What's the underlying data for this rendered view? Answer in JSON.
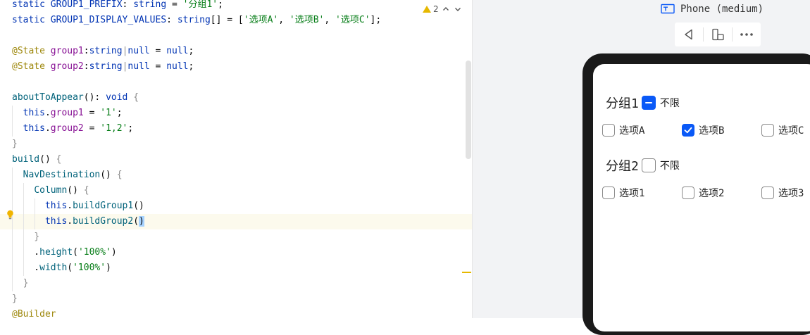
{
  "editor": {
    "warning_count": "2",
    "lines": [
      {
        "hl": false,
        "guides": [],
        "tokens": [
          [
            "k",
            "static "
          ],
          [
            "v",
            "GROUP1_PREFIX"
          ],
          [
            "n",
            ": "
          ],
          [
            "k",
            "string"
          ],
          [
            "n",
            " = "
          ],
          [
            "s",
            "'分组1'"
          ],
          [
            "n",
            ";"
          ]
        ]
      },
      {
        "hl": false,
        "guides": [],
        "tokens": [
          [
            "k",
            "static "
          ],
          [
            "v",
            "GROUP1_DISPLAY_VALUES"
          ],
          [
            "n",
            ": "
          ],
          [
            "k",
            "string"
          ],
          [
            "n",
            "[] = ["
          ],
          [
            "s",
            "'选项A'"
          ],
          [
            "n",
            ", "
          ],
          [
            "s",
            "'选项B'"
          ],
          [
            "n",
            ", "
          ],
          [
            "s",
            "'选项C'"
          ],
          [
            "n",
            "];"
          ]
        ]
      },
      {
        "hl": false,
        "guides": [],
        "tokens": []
      },
      {
        "hl": false,
        "guides": [],
        "tokens": [
          [
            "a",
            "@State "
          ],
          [
            "t",
            "group1"
          ],
          [
            "n",
            ":"
          ],
          [
            "k",
            "string"
          ],
          [
            "g",
            "|"
          ],
          [
            "k",
            "null"
          ],
          [
            "n",
            " = "
          ],
          [
            "k",
            "null"
          ],
          [
            "n",
            ";"
          ]
        ]
      },
      {
        "hl": false,
        "guides": [],
        "tokens": [
          [
            "a",
            "@State "
          ],
          [
            "t",
            "group2"
          ],
          [
            "n",
            ":"
          ],
          [
            "k",
            "string"
          ],
          [
            "g",
            "|"
          ],
          [
            "k",
            "null"
          ],
          [
            "n",
            " = "
          ],
          [
            "k",
            "null"
          ],
          [
            "n",
            ";"
          ]
        ]
      },
      {
        "hl": false,
        "guides": [],
        "tokens": []
      },
      {
        "hl": false,
        "guides": [],
        "tokens": [
          [
            "f",
            "aboutToAppear"
          ],
          [
            "n",
            "(): "
          ],
          [
            "k",
            "void "
          ],
          [
            "br",
            "{"
          ]
        ]
      },
      {
        "hl": false,
        "guides": [
          17
        ],
        "tokens": [
          [
            "n",
            "  "
          ],
          [
            "th",
            "this"
          ],
          [
            "n",
            "."
          ],
          [
            "t",
            "group1"
          ],
          [
            "n",
            " = "
          ],
          [
            "s",
            "'1'"
          ],
          [
            "n",
            ";"
          ]
        ]
      },
      {
        "hl": false,
        "guides": [
          17
        ],
        "tokens": [
          [
            "n",
            "  "
          ],
          [
            "th",
            "this"
          ],
          [
            "n",
            "."
          ],
          [
            "t",
            "group2"
          ],
          [
            "n",
            " = "
          ],
          [
            "s",
            "'1,2'"
          ],
          [
            "n",
            ";"
          ]
        ]
      },
      {
        "hl": false,
        "guides": [],
        "tokens": [
          [
            "br",
            "}"
          ]
        ]
      },
      {
        "hl": false,
        "guides": [],
        "tokens": [
          [
            "f",
            "build"
          ],
          [
            "n",
            "() "
          ],
          [
            "br",
            "{"
          ]
        ]
      },
      {
        "hl": false,
        "guides": [
          17
        ],
        "tokens": [
          [
            "n",
            "  "
          ],
          [
            "f",
            "NavDestination"
          ],
          [
            "n",
            "() "
          ],
          [
            "br",
            "{"
          ]
        ]
      },
      {
        "hl": false,
        "guides": [
          17,
          33
        ],
        "tokens": [
          [
            "n",
            "    "
          ],
          [
            "f",
            "Column"
          ],
          [
            "n",
            "() "
          ],
          [
            "br",
            "{"
          ]
        ]
      },
      {
        "hl": false,
        "guides": [
          17,
          33,
          49
        ],
        "tokens": [
          [
            "n",
            "      "
          ],
          [
            "th",
            "this"
          ],
          [
            "n",
            "."
          ],
          [
            "f",
            "buildGroup1"
          ],
          [
            "n",
            "()"
          ]
        ]
      },
      {
        "hl": true,
        "guides": [
          17,
          33,
          49
        ],
        "tokens": [
          [
            "n",
            "      "
          ],
          [
            "th",
            "this"
          ],
          [
            "n",
            "."
          ],
          [
            "f",
            "buildGroup2"
          ],
          [
            "n",
            "("
          ],
          [
            "c",
            ")"
          ]
        ]
      },
      {
        "hl": false,
        "guides": [
          17,
          33
        ],
        "tokens": [
          [
            "n",
            "    "
          ],
          [
            "br",
            "}"
          ]
        ]
      },
      {
        "hl": false,
        "guides": [
          17,
          33
        ],
        "tokens": [
          [
            "n",
            "    ."
          ],
          [
            "f",
            "height"
          ],
          [
            "n",
            "("
          ],
          [
            "s",
            "'100%'"
          ],
          [
            "n",
            ")"
          ]
        ]
      },
      {
        "hl": false,
        "guides": [
          17,
          33
        ],
        "tokens": [
          [
            "n",
            "    ."
          ],
          [
            "f",
            "width"
          ],
          [
            "n",
            "("
          ],
          [
            "s",
            "'100%'"
          ],
          [
            "n",
            ")"
          ]
        ]
      },
      {
        "hl": false,
        "guides": [
          17
        ],
        "tokens": [
          [
            "n",
            "  "
          ],
          [
            "br",
            "}"
          ]
        ]
      },
      {
        "hl": false,
        "guides": [],
        "tokens": [
          [
            "br",
            "}"
          ]
        ]
      },
      {
        "hl": false,
        "guides": [],
        "tokens": [
          [
            "a",
            "@Builder"
          ]
        ]
      }
    ]
  },
  "preview": {
    "device_label": "Phone (medium)",
    "group1": {
      "title": "分组1",
      "select_all_label": "不限",
      "select_all_state": "partial",
      "options": [
        {
          "label": "选项A",
          "checked": false
        },
        {
          "label": "选项B",
          "checked": true
        },
        {
          "label": "选项C",
          "checked": false
        }
      ]
    },
    "group2": {
      "title": "分组2",
      "select_all_label": "不限",
      "select_all_state": "unchecked",
      "options": [
        {
          "label": "选项1",
          "checked": false
        },
        {
          "label": "选项2",
          "checked": false
        },
        {
          "label": "选项3",
          "checked": false
        }
      ]
    },
    "colors": {
      "accent": "#0a59f7",
      "frame": "#1a1a1a"
    }
  }
}
